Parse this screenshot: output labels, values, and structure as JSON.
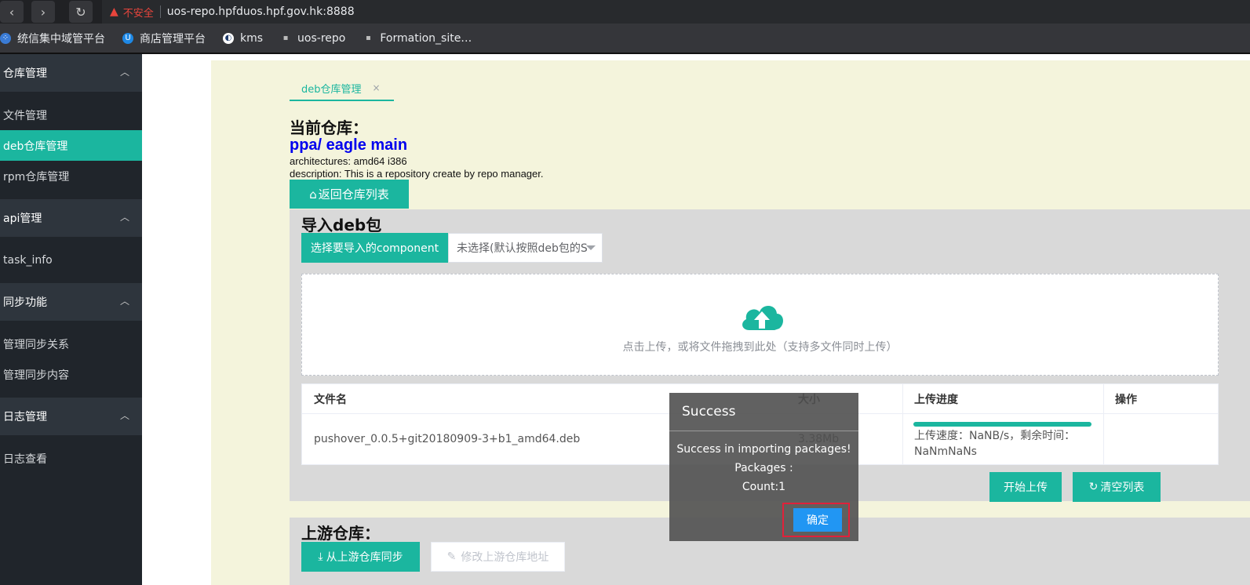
{
  "browser": {
    "url": "uos-repo.hpfduos.hpf.gov.hk:8888",
    "security_label": "不安全",
    "bookmarks": [
      {
        "label": "统信集中域管平台",
        "icon": "uos-icon"
      },
      {
        "label": "商店管理平台",
        "icon": "store-icon"
      },
      {
        "label": "kms",
        "icon": "kms-icon"
      },
      {
        "label": "uos-repo",
        "icon": "repo-icon"
      },
      {
        "label": "Formation_site…",
        "icon": "site-icon"
      }
    ]
  },
  "sidebar": {
    "groups": [
      {
        "label": "仓库管理",
        "items": [
          "文件管理",
          "deb仓库管理",
          "rpm仓库管理"
        ]
      },
      {
        "label": "api管理",
        "items": [
          "task_info"
        ]
      },
      {
        "label": "同步功能",
        "items": [
          "管理同步关系",
          "管理同步内容"
        ]
      },
      {
        "label": "日志管理",
        "items": [
          "日志查看"
        ]
      }
    ],
    "active_item": "deb仓库管理"
  },
  "tab": {
    "label": "deb仓库管理",
    "close": "×"
  },
  "repo": {
    "heading": "当前仓库：",
    "name": "ppa/ eagle main",
    "architectures": "architectures: amd64 i386",
    "description": "description: This is a repository create by repo manager.",
    "back_button": "返回仓库列表"
  },
  "import": {
    "heading": "导入deb包",
    "component_label": "选择要导入的component",
    "component_value": "未选择(默认按照deb包的S",
    "drop_hint": "点击上传，或将文件拖拽到此处（支持多文件同时上传）",
    "columns": [
      "文件名",
      "大小",
      "上传进度",
      "操作"
    ],
    "rows": [
      {
        "filename": "pushover_0.0.5+git20180909-3+b1_amd64.deb",
        "size": "3.38Mb",
        "progress": 1.0,
        "speed_line1": "上传速度：NaNB/s，剩余时间：",
        "speed_line2": "NaNmNaNs"
      }
    ],
    "start_button": "开始上传",
    "clear_button": "清空列表"
  },
  "upstream": {
    "heading": "上游仓库：",
    "sync_button": "从上游仓库同步",
    "edit_button": "修改上游仓库地址"
  },
  "dialog": {
    "title": "Success",
    "line1": "Success in importing packages!",
    "line2": "Packages :",
    "line3": "Count:1",
    "ok_button": "确定"
  },
  "colors": {
    "accent": "#1bb69f",
    "sidebar_bg": "#20252b",
    "link": "#0000ee",
    "dialog_ok": "#2196f3"
  }
}
